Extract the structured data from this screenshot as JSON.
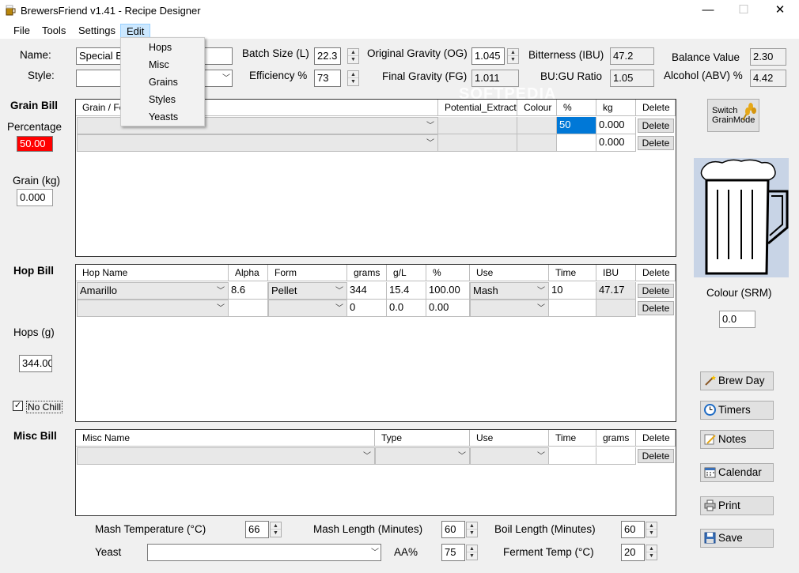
{
  "window": {
    "title": "BrewersFriend v1.41 - Recipe Designer"
  },
  "menu": {
    "file": "File",
    "tools": "Tools",
    "settings": "Settings",
    "edit": "Edit"
  },
  "edit_menu": {
    "items": [
      "Hops",
      "Misc",
      "Grains",
      "Styles",
      "Yeasts"
    ]
  },
  "recipe": {
    "name_label": "Name:",
    "name_value": "Special B",
    "style_label": "Style:",
    "style_value": "",
    "batch_size_label": "Batch Size (L)",
    "batch_size_value": "22.3",
    "efficiency_label": "Efficiency %",
    "efficiency_value": "73",
    "og_label": "Original Gravity (OG)",
    "og_value": "1.045",
    "fg_label": "Final Gravity (FG)",
    "fg_value": "1.011",
    "ibu_label": "Bitterness (IBU)",
    "ibu_value": "47.2",
    "bugu_label": "BU:GU Ratio",
    "bugu_value": "1.05",
    "balance_label": "Balance Value",
    "balance_value": "2.30",
    "abv_label": "Alcohol (ABV) %",
    "abv_value": "4.42"
  },
  "grain_bill": {
    "title": "Grain Bill",
    "percentage_label": "Percentage",
    "percentage_value": "50.00",
    "grain_kg_label": "Grain (kg)",
    "grain_kg_value": "0.000",
    "columns": [
      "Grain / Fe",
      "Potential_Extract",
      "Colour",
      "%",
      "kg",
      "Delete"
    ],
    "rows": [
      {
        "name": "",
        "extract": "",
        "colour": "",
        "pct": "50",
        "kg": "0.000",
        "delete": "Delete"
      },
      {
        "name": "",
        "extract": "",
        "colour": "",
        "pct": "",
        "kg": "0.000",
        "delete": "Delete"
      }
    ]
  },
  "hop_bill": {
    "title": "Hop Bill",
    "hops_label": "Hops (g)",
    "hops_value": "344.00",
    "no_chill_label": "No Chill",
    "columns": [
      "Hop Name",
      "Alpha",
      "Form",
      "grams",
      "g/L",
      "%",
      "Use",
      "Time",
      "IBU",
      "Delete"
    ],
    "rows": [
      {
        "name": "Amarillo",
        "alpha": "8.6",
        "form": "Pellet",
        "grams": "344",
        "gl": "15.4",
        "pct": "100.00",
        "use": "Mash",
        "time": "10",
        "ibu": "47.17",
        "delete": "Delete"
      },
      {
        "name": "",
        "alpha": "",
        "form": "",
        "grams": "0",
        "gl": "0.0",
        "pct": "0.00",
        "use": "",
        "time": "",
        "ibu": "",
        "delete": "Delete"
      }
    ]
  },
  "misc_bill": {
    "title": "Misc Bill",
    "columns": [
      "Misc Name",
      "Type",
      "Use",
      "Time",
      "grams",
      "Delete"
    ],
    "rows": [
      {
        "delete": "Delete"
      }
    ]
  },
  "bottom": {
    "mash_temp_label": "Mash Temperature (°C)",
    "mash_temp_value": "66",
    "mash_length_label": "Mash Length (Minutes)",
    "mash_length_value": "60",
    "boil_length_label": "Boil Length (Minutes)",
    "boil_length_value": "60",
    "yeast_label": "Yeast",
    "yeast_value": "",
    "aa_label": "AA%",
    "aa_value": "75",
    "ferment_label": "Ferment Temp (°C)",
    "ferment_value": "20"
  },
  "sidebar": {
    "switch_label_1": "Switch",
    "switch_label_2": "GrainMode",
    "colour_label": "Colour (SRM)",
    "colour_value": "0.0",
    "buttons": [
      "Brew Day",
      "Timers",
      "Notes",
      "Calendar",
      "Print",
      "Save"
    ]
  },
  "watermark": "SOFTPEDIA",
  "colors": {
    "selection": "#0078d7",
    "warning_red": "#ff0000",
    "glass_bg": "#c8d4e6"
  }
}
